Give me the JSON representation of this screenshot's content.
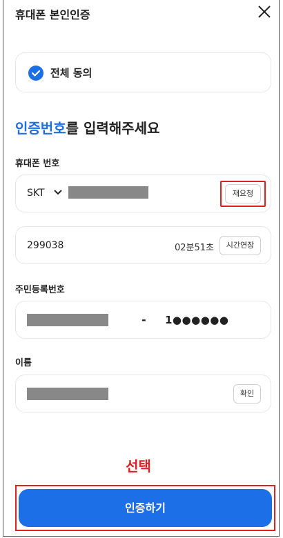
{
  "header": {
    "title": "휴대폰 본인인증",
    "close_icon": "close-icon"
  },
  "agreement": {
    "label": "전체 동의",
    "checked": true,
    "check_color": "#1c6fe6"
  },
  "headline": {
    "accent_text": "인증번호",
    "rest_text": "를 입력해주세요"
  },
  "phone": {
    "section_label": "휴대폰 번호",
    "carrier": "SKT",
    "number_masked": true,
    "resend_label": "재요청"
  },
  "code": {
    "value": "299038",
    "timer": "02분51초",
    "extend_label": "시간연장"
  },
  "rrn": {
    "section_label": "주민등록번호",
    "front_masked": true,
    "separator": "-",
    "back_display": "1●●●●●●"
  },
  "name": {
    "section_label": "이름",
    "value_masked": true,
    "confirm_label": "확인"
  },
  "annotation": {
    "select_label": "선택",
    "highlight_color": "#e02020"
  },
  "submit": {
    "label": "인증하기",
    "color": "#1c6fe6"
  }
}
